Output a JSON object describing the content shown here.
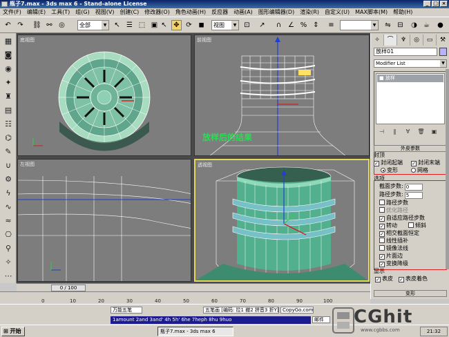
{
  "window": {
    "title": "瓶子7.max - 3ds max 6 - Stand-alone License"
  },
  "menu": [
    "文件(F)",
    "编辑(E)",
    "工具(T)",
    "组(G)",
    "视图(V)",
    "创建(C)",
    "修改器(O)",
    "角色动画(H)",
    "反应器",
    "动画(A)",
    "图形编辑器(D)",
    "渲染(R)",
    "自定义(U)",
    "MAX脚本(M)",
    "帮助(H)"
  ],
  "toolbar": {
    "selection_filter": "全部",
    "ref_coord": "视图"
  },
  "viewports": {
    "top_left": "底视图",
    "top_right": "前视图",
    "bottom_left": "左视图",
    "bottom_right": "透视图",
    "caption": "放样后的结果"
  },
  "command_panel": {
    "object_name": "放样01",
    "modifier_list": "Modifier List",
    "stack_item": "放样",
    "rollout_top": "外皮参数",
    "capping": {
      "title": "封顶",
      "cap_start": "封闭起端",
      "cap_end": "封闭末端",
      "morph": "变形",
      "grid": "网格"
    },
    "options": {
      "title": "选项",
      "shape_steps_label": "截面步数:",
      "shape_steps": "0",
      "path_steps_label": "路径步数:",
      "path_steps": "5",
      "optimize_shapes": "路径步数",
      "optimize_path": "优化路径",
      "adaptive_path": "自适应路径步数",
      "contour": "转动",
      "banking": "倾斜",
      "constant_cross": "相交截面恒定",
      "linear_interp": "线性插补",
      "flip_normals": "镜像法线",
      "quad_sides": "片面边",
      "transform_degrade": "变换降级"
    },
    "display": {
      "title": "显示",
      "skin": "表皮",
      "skin_shaded": "表皮着色"
    },
    "rollout_bottom": "变形"
  },
  "timeline": {
    "slider": "0 / 100",
    "ticks": [
      "0",
      "10",
      "20",
      "30",
      "40",
      "50",
      "60",
      "70",
      "80",
      "90",
      "100"
    ]
  },
  "status": {
    "ime_name": "万能五笔",
    "ime_mode": "五笔画 [编码: 拉1 撤2 拼音3 折Y]",
    "ime_site": "CopyGo.com",
    "ime_candidates": "1amount 2and 3and' 4h 5h' 6he 7heph 8hu 9huo",
    "ime_extra": "邮件"
  },
  "taskbar": {
    "start": "开始",
    "task": "瓶子7.max - 3ds max 6",
    "clock": "21:32"
  },
  "watermark": {
    "logo": "CGhit",
    "url": "www.cgbbs.com"
  }
}
